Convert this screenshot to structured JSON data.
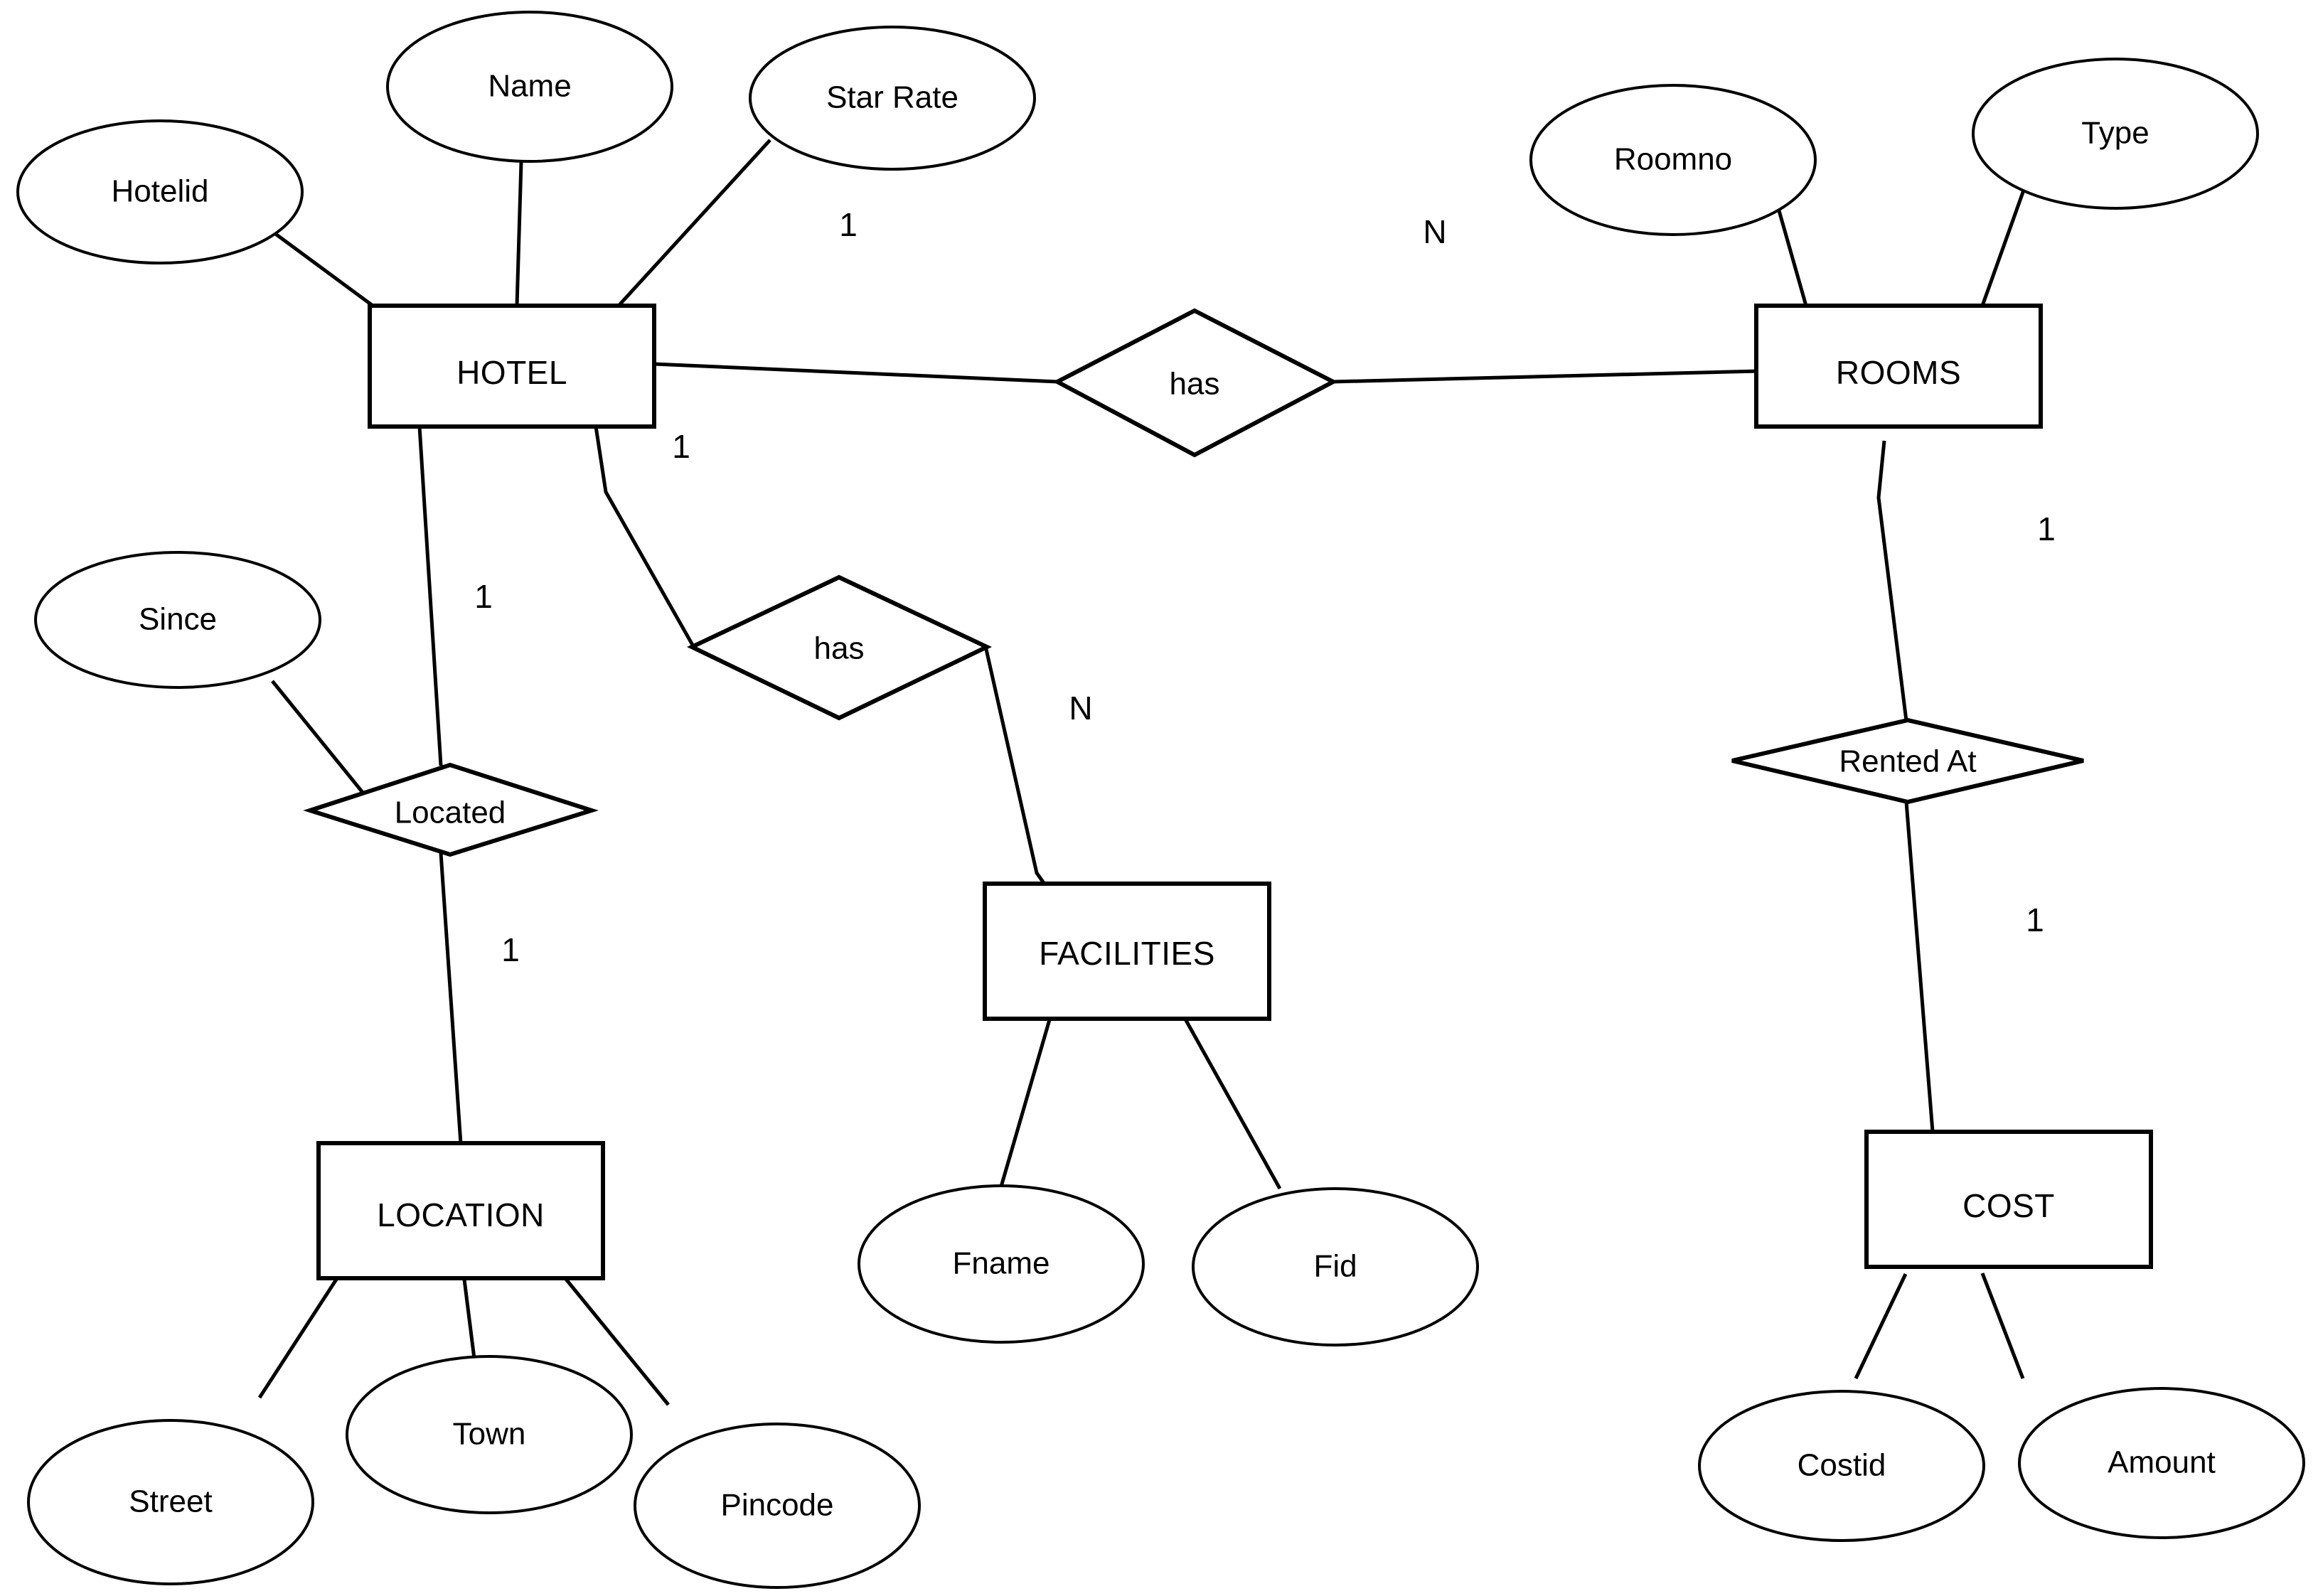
{
  "diagram": {
    "title": "Hotel ER Diagram",
    "type": "entity-relationship",
    "background_color": "#ffffff",
    "line_color": "#000000"
  },
  "entities": [
    {
      "id": "hotel",
      "label": "HOTEL"
    },
    {
      "id": "rooms",
      "label": "ROOMS"
    },
    {
      "id": "facilities",
      "label": "FACILITIES"
    },
    {
      "id": "location",
      "label": "LOCATION"
    },
    {
      "id": "cost",
      "label": "COST"
    }
  ],
  "attributes": [
    {
      "id": "hotelid",
      "label": "Hotelid",
      "owner": "hotel"
    },
    {
      "id": "name",
      "label": "Name",
      "owner": "hotel"
    },
    {
      "id": "starrate",
      "label": "Star Rate",
      "owner": "hotel"
    },
    {
      "id": "roomno",
      "label": "Roomno",
      "owner": "rooms"
    },
    {
      "id": "type",
      "label": "Type",
      "owner": "rooms"
    },
    {
      "id": "since",
      "label": "Since",
      "owner": "located"
    },
    {
      "id": "fname",
      "label": "Fname",
      "owner": "facilities"
    },
    {
      "id": "fid",
      "label": "Fid",
      "owner": "facilities"
    },
    {
      "id": "street",
      "label": "Street",
      "owner": "location"
    },
    {
      "id": "town",
      "label": "Town",
      "owner": "location"
    },
    {
      "id": "pincode",
      "label": "Pincode",
      "owner": "location"
    },
    {
      "id": "costid",
      "label": "Costid",
      "owner": "cost"
    },
    {
      "id": "amount",
      "label": "Amount",
      "owner": "cost"
    }
  ],
  "relationships": [
    {
      "id": "has_rooms",
      "label": "has",
      "from": "hotel",
      "to": "rooms",
      "from_cardinality": "1",
      "to_cardinality": "N"
    },
    {
      "id": "has_facilities",
      "label": "has",
      "from": "hotel",
      "to": "facilities",
      "from_cardinality": "1",
      "to_cardinality": "N"
    },
    {
      "id": "located",
      "label": "Located",
      "from": "hotel",
      "to": "location",
      "from_cardinality": "1",
      "to_cardinality": "1"
    },
    {
      "id": "rented_at",
      "label": "Rented At",
      "from": "rooms",
      "to": "cost",
      "from_cardinality": "1",
      "to_cardinality": "1"
    }
  ],
  "cardinality_markers": [
    {
      "id": "card-hotel-rooms",
      "value": "1"
    },
    {
      "id": "card-rooms-has",
      "value": "N"
    },
    {
      "id": "card-hotel-located",
      "value": "1"
    },
    {
      "id": "card-hotel-facilities",
      "value": "1"
    },
    {
      "id": "card-facilities-n",
      "value": "N"
    },
    {
      "id": "card-located-location",
      "value": "1"
    },
    {
      "id": "card-rooms-rented",
      "value": "1"
    },
    {
      "id": "card-cost-rented",
      "value": "1"
    }
  ],
  "labels": {
    "hotel": "HOTEL",
    "rooms": "ROOMS",
    "facilities": "FACILITIES",
    "location": "LOCATION",
    "cost": "COST",
    "hotelid": "Hotelid",
    "name": "Name",
    "starrate": "Star Rate",
    "roomno": "Roomno",
    "type": "Type",
    "since": "Since",
    "fname": "Fname",
    "fid": "Fid",
    "street": "Street",
    "town": "Town",
    "pincode": "Pincode",
    "costid": "Costid",
    "amount": "Amount",
    "has_rooms": "has",
    "has_facilities": "has",
    "located": "Located",
    "rented_at": "Rented At",
    "card_1a": "1",
    "card_Na": "N",
    "card_1b": "1",
    "card_1c": "1",
    "card_Nb": "N",
    "card_1d": "1",
    "card_1e": "1",
    "card_1f": "1"
  }
}
